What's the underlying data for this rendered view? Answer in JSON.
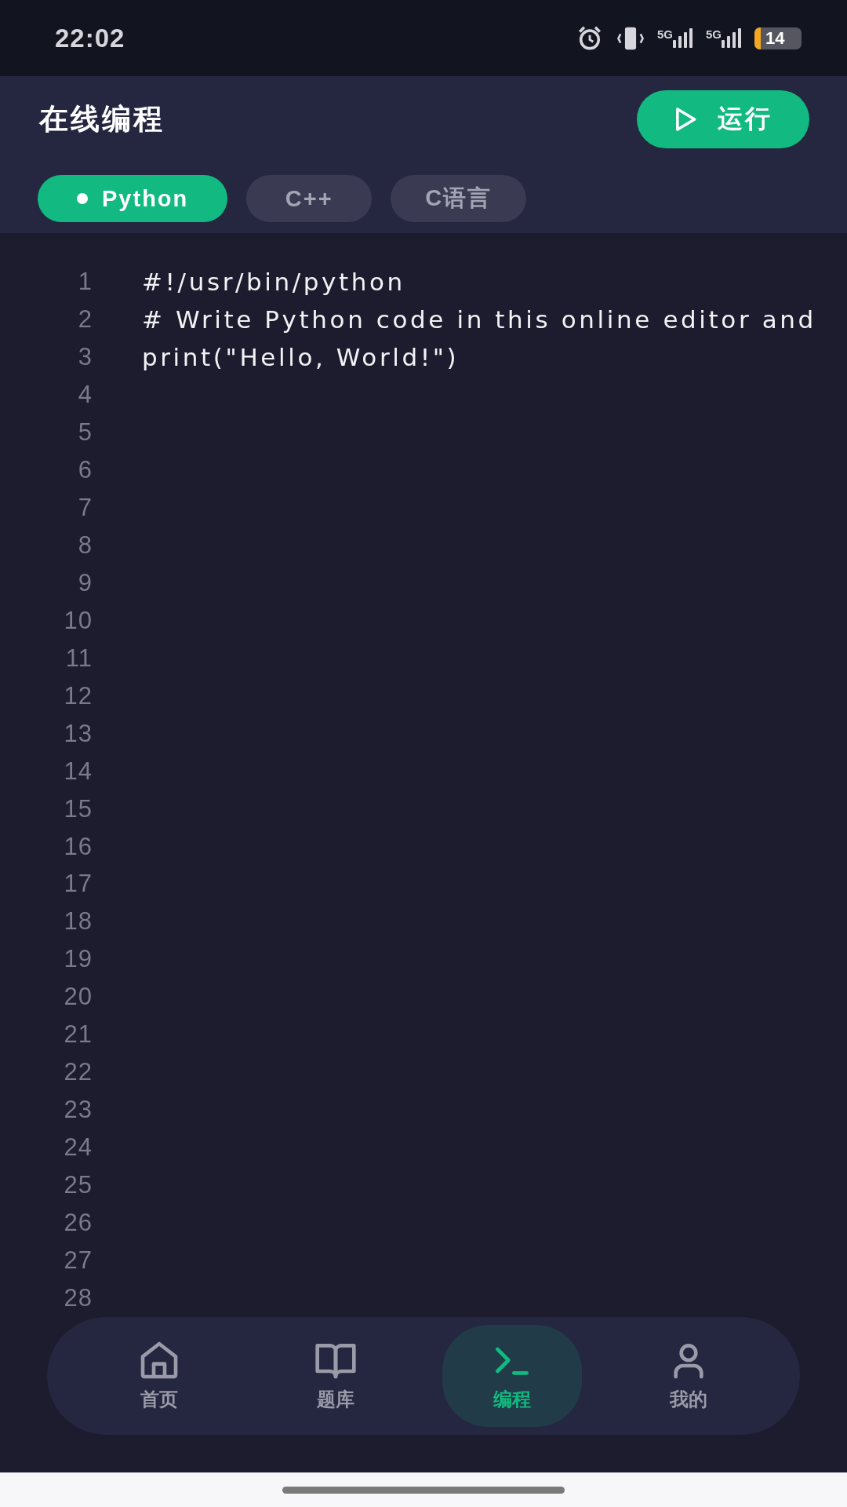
{
  "status_bar": {
    "time": "22:02",
    "network_1": "5G",
    "network_2": "5G",
    "battery": "14"
  },
  "header": {
    "title": "在线编程",
    "run_button": "运行"
  },
  "tabs": [
    {
      "label": "Python",
      "selected": true
    },
    {
      "label": "C++",
      "selected": false
    },
    {
      "label": "C语言",
      "selected": false
    }
  ],
  "editor": {
    "lines": [
      {
        "number": "1",
        "code": "#!/usr/bin/python"
      },
      {
        "number": "2",
        "code": "# Write Python code in this online editor and"
      },
      {
        "number": "3",
        "code": "print(\"Hello, World!\")"
      },
      {
        "number": "4"
      },
      {
        "number": "5"
      },
      {
        "number": "6"
      },
      {
        "number": "7"
      },
      {
        "number": "8"
      },
      {
        "number": "9"
      },
      {
        "number": "10"
      },
      {
        "number": "11"
      },
      {
        "number": "12"
      },
      {
        "number": "13"
      },
      {
        "number": "14"
      },
      {
        "number": "15"
      },
      {
        "number": "16"
      },
      {
        "number": "17"
      },
      {
        "number": "18"
      },
      {
        "number": "19"
      },
      {
        "number": "20"
      },
      {
        "number": "21"
      },
      {
        "number": "22"
      },
      {
        "number": "23"
      },
      {
        "number": "24"
      },
      {
        "number": "25"
      },
      {
        "number": "26"
      },
      {
        "number": "27"
      },
      {
        "number": "28"
      }
    ]
  },
  "bottom_nav": [
    {
      "label": "首页",
      "kind": "home",
      "selected": false
    },
    {
      "label": "题库",
      "kind": "book",
      "selected": false
    },
    {
      "label": "编程",
      "kind": "terminal",
      "selected": true
    },
    {
      "label": "我的",
      "kind": "user",
      "selected": false
    }
  ]
}
